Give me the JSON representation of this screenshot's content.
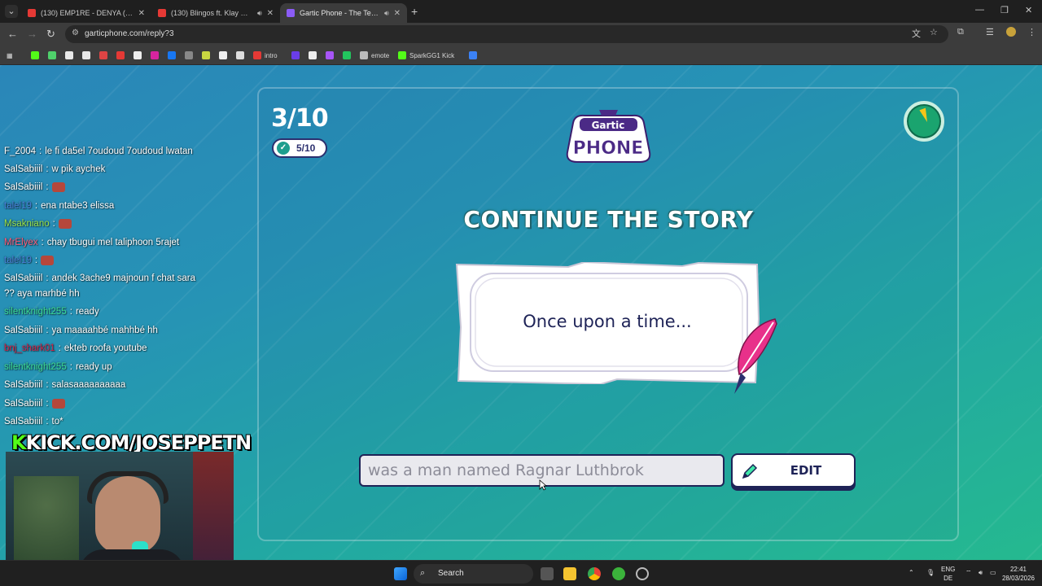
{
  "browser": {
    "tabs": [
      {
        "title": "(130) EMP1RE - DENYA ( Officia",
        "favicon": "youtube",
        "active": false,
        "audio": false
      },
      {
        "title": "(130) Blingos ft. Klay Bbj &",
        "favicon": "youtube",
        "active": false,
        "audio": true
      },
      {
        "title": "Gartic Phone - The Telepho",
        "favicon": "gartic",
        "active": true,
        "audio": true
      }
    ],
    "url": "garticphone.com/reply?3",
    "bookmarks": [
      {
        "label": "",
        "icon": "kick-icon",
        "color": "#53fc18"
      },
      {
        "label": "",
        "icon": "d-icon",
        "color": "#4fd06b"
      },
      {
        "label": "",
        "icon": "diamond-icon",
        "color": "#e8e8e8"
      },
      {
        "label": "",
        "icon": "download-icon",
        "color": "#e8e8e8"
      },
      {
        "label": "",
        "icon": "m-icon",
        "color": "#d44"
      },
      {
        "label": "",
        "icon": "youtube-icon",
        "color": "#e53935"
      },
      {
        "label": "",
        "icon": "tiktok-icon",
        "color": "#eee"
      },
      {
        "label": "",
        "icon": "instagram-icon",
        "color": "#d6249f"
      },
      {
        "label": "",
        "icon": "facebook-icon",
        "color": "#1877f2"
      },
      {
        "label": "",
        "icon": "grid-icon",
        "color": "#888"
      },
      {
        "label": "",
        "icon": "star-icon",
        "color": "#c9d641"
      },
      {
        "label": "",
        "icon": "o-icon",
        "color": "#eee"
      },
      {
        "label": "",
        "icon": "doc-icon",
        "color": "#ddd"
      },
      {
        "label": "intro",
        "icon": "youtube-icon",
        "color": "#e53935"
      },
      {
        "label": "",
        "icon": "v-icon",
        "color": "#6a3de8"
      },
      {
        "label": "",
        "icon": "p-icon",
        "color": "#eee"
      },
      {
        "label": "",
        "icon": "gamepad-icon",
        "color": "#a855f7"
      },
      {
        "label": "",
        "icon": "circle-icon",
        "color": "#22c55e"
      },
      {
        "label": "emote",
        "icon": "emote-icon",
        "color": "#bbb"
      },
      {
        "label": "SparkGG1 Kick",
        "icon": "kick-icon",
        "color": "#53fc18"
      },
      {
        "label": "",
        "icon": "meta-icon",
        "color": "#3b82f6"
      }
    ]
  },
  "game": {
    "round": "3/10",
    "done_count": "5/10",
    "heading": "CONTINUE THE STORY",
    "prompt": "Once upon a time...",
    "answer_value": "was a man named Ragnar Luthbrok",
    "edit_label": "EDIT",
    "logo_top": "Gartic",
    "logo_bottom": "PHONE",
    "timer_progress": 0.06
  },
  "chat": {
    "messages": [
      {
        "user": "F_2004",
        "user_color": "#ffffff",
        "text": "le fi da5el 7oudoud 7oudoud lwatan",
        "emote": false
      },
      {
        "user": "SalSabiiil",
        "user_color": "#ffffff",
        "text": "w pik aychek",
        "emote": false
      },
      {
        "user": "SalSabiiil",
        "user_color": "#ffffff",
        "text": "",
        "emote": true
      },
      {
        "user": "talel19",
        "user_color": "#4a7fd8",
        "text": "ena ntabe3 elissa",
        "emote": false
      },
      {
        "user": "Msakniano",
        "user_color": "#9be34a",
        "text": "",
        "emote": true
      },
      {
        "user": "MrElyex",
        "user_color": "#ff5c7a",
        "text": "chay tbugui mel taliphoon 5rajet",
        "emote": false
      },
      {
        "user": "talel19",
        "user_color": "#4a7fd8",
        "text": "",
        "emote": true
      },
      {
        "user": "SalSabiiil",
        "user_color": "#ffffff",
        "text": "andek 3ache9 majnoun f chat sara",
        "emote": false
      },
      {
        "user": "",
        "user_color": "#ffffff",
        "text": "?? aya marhbé hh",
        "emote": false
      },
      {
        "user": "silentknight255",
        "user_color": "#3ddc97",
        "text": "ready",
        "emote": false
      },
      {
        "user": "SalSabiiil",
        "user_color": "#ffffff",
        "text": "ya maaaahbé mahhbé hh",
        "emote": false
      },
      {
        "user": "bnj_shark01",
        "user_color": "#d2254a",
        "text": "ekteb roofa youtube",
        "emote": false
      },
      {
        "user": "silentknight255",
        "user_color": "#3ddc97",
        "text": "ready up",
        "emote": false
      },
      {
        "user": "SalSabiiil",
        "user_color": "#ffffff",
        "text": "salasaaaaaaaaaa",
        "emote": false
      },
      {
        "user": "SalSabiiil",
        "user_color": "#ffffff",
        "text": "",
        "emote": true
      },
      {
        "user": "SalSabiiil",
        "user_color": "#ffffff",
        "text": "to*",
        "emote": false
      }
    ],
    "separator": ":",
    "overlay_brand": "KICK.COM/JOSEPPETN"
  },
  "taskbar": {
    "search_placeholder": "Search",
    "lang_top": "ENG",
    "lang_bottom": "DE",
    "time": "22:41",
    "date": "28/03/2026"
  }
}
